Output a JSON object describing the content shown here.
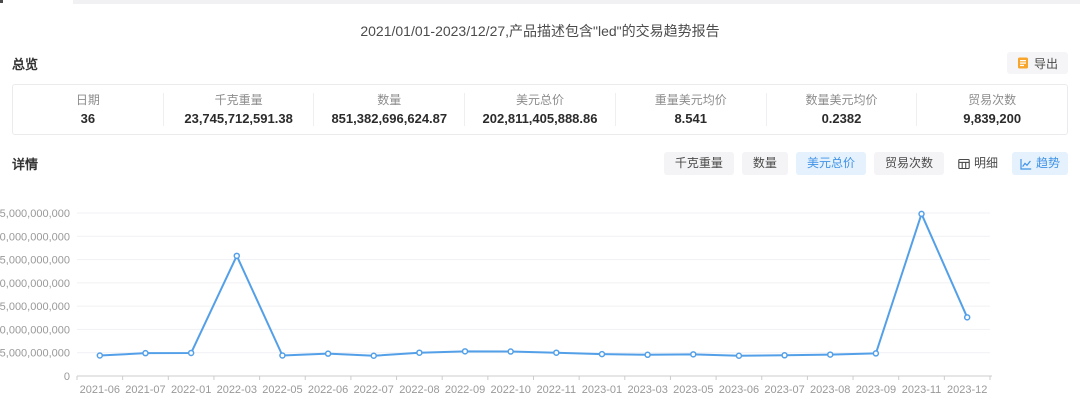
{
  "page": {
    "title": "2021/01/01-2023/12/27,产品描述包含\"led\"的交易趋势报告"
  },
  "overview": {
    "label": "总览",
    "export_label": "导出",
    "stats": [
      {
        "label": "日期",
        "value": "36"
      },
      {
        "label": "千克重量",
        "value": "23,745,712,591.38"
      },
      {
        "label": "数量",
        "value": "851,382,696,624.87"
      },
      {
        "label": "美元总价",
        "value": "202,811,405,888.86"
      },
      {
        "label": "重量美元均价",
        "value": "8.541"
      },
      {
        "label": "数量美元均价",
        "value": "0.2382"
      },
      {
        "label": "贸易次数",
        "value": "9,839,200"
      }
    ]
  },
  "details": {
    "label": "详情",
    "metric_buttons": [
      {
        "label": "千克重量",
        "active": false
      },
      {
        "label": "数量",
        "active": false
      },
      {
        "label": "美元总价",
        "active": true
      },
      {
        "label": "贸易次数",
        "active": false
      }
    ],
    "view_buttons": [
      {
        "label": "明细",
        "icon": "table-icon",
        "active": false
      },
      {
        "label": "趋势",
        "icon": "trend-chart-icon",
        "active": true
      }
    ]
  },
  "colors": {
    "accent_blue": "#4093e6",
    "active_button_bg": "#e5f1fd",
    "line_blue": "#54a0e8",
    "export_icon_orange": "#f7a52c",
    "axis_label_gray": "#999999"
  },
  "chart_data": {
    "type": "line",
    "title": "",
    "xlabel": "",
    "ylabel": "",
    "x": [
      "2021-06",
      "2021-07",
      "2022-01",
      "2022-03",
      "2022-05",
      "2022-06",
      "2022-07",
      "2022-08",
      "2022-09",
      "2022-10",
      "2022-11",
      "2023-01",
      "2023-03",
      "2023-05",
      "2023-06",
      "2023-07",
      "2023-08",
      "2023-09",
      "2023-11",
      "2023-12"
    ],
    "series": [
      {
        "name": "美元总价",
        "color": "#54a0e8",
        "values": [
          4400000000,
          4900000000,
          4950000000,
          25800000000,
          4400000000,
          4800000000,
          4350000000,
          5000000000,
          5300000000,
          5250000000,
          5000000000,
          4700000000,
          4550000000,
          4650000000,
          4350000000,
          4450000000,
          4600000000,
          4850000000,
          34800000000,
          12600000000
        ]
      }
    ],
    "ylim": [
      0,
      35000000000
    ],
    "ytick_interval": 5000000000,
    "grid": true,
    "legend": "none"
  }
}
